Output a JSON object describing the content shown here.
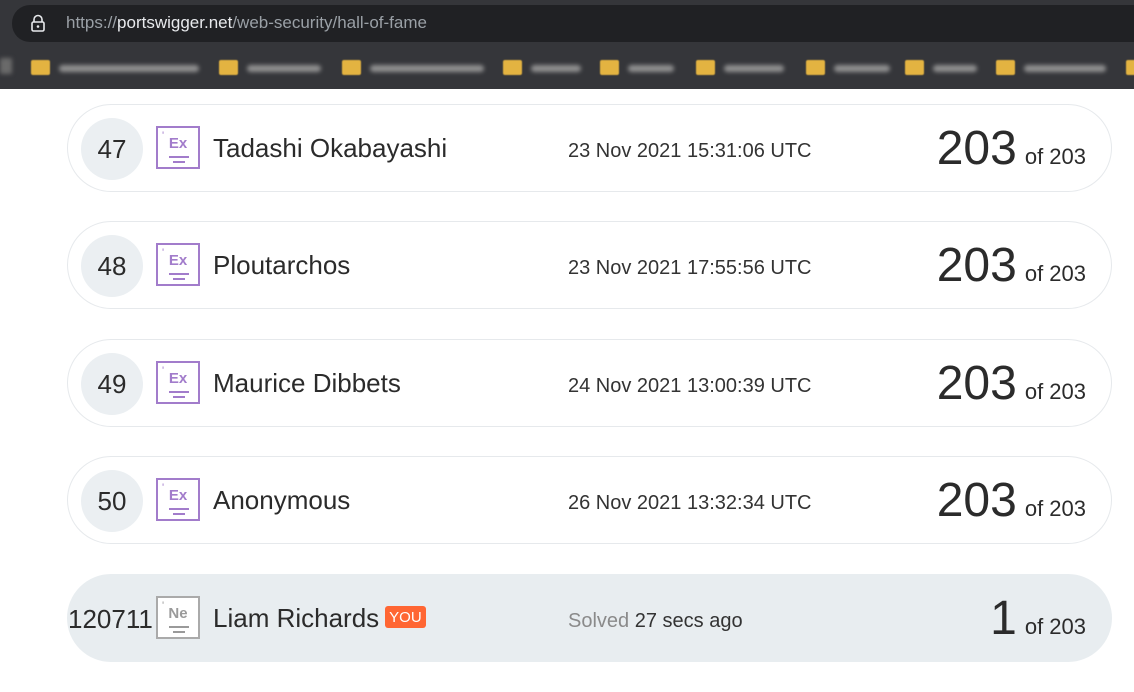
{
  "browser": {
    "url_scheme": "https://",
    "url_host": "portswigger.net",
    "url_path": "/web-security/hall-of-fame"
  },
  "bookmarks_bar": {
    "items": [
      {
        "icon": "folder-icon",
        "label_blurred": true
      },
      {
        "icon": "folder-icon",
        "label_blurred": true
      },
      {
        "icon": "folder-icon",
        "label_blurred": true
      },
      {
        "icon": "folder-icon",
        "label_blurred": true
      },
      {
        "icon": "folder-icon",
        "label_blurred": true
      },
      {
        "icon": "folder-icon",
        "label_blurred": true
      },
      {
        "icon": "folder-icon",
        "label_blurred": true
      },
      {
        "icon": "folder-icon",
        "label_blurred": true
      },
      {
        "icon": "folder-icon",
        "label_blurred": true
      }
    ]
  },
  "leaderboard": {
    "rows": [
      {
        "rank": "47",
        "badge": "Ex",
        "name": "Tadashi Okabayashi",
        "time": "23 Nov 2021 15:31:06 UTC",
        "score": "203",
        "total": "of 203"
      },
      {
        "rank": "48",
        "badge": "Ex",
        "name": "Ploutarchos",
        "time": "23 Nov 2021 17:55:56 UTC",
        "score": "203",
        "total": "of 203"
      },
      {
        "rank": "49",
        "badge": "Ex",
        "name": "Maurice Dibbets",
        "time": "24 Nov 2021 13:00:39 UTC",
        "score": "203",
        "total": "of 203"
      },
      {
        "rank": "50",
        "badge": "Ex",
        "name": "Anonymous",
        "time": "26 Nov 2021 13:32:34 UTC",
        "score": "203",
        "total": "of 203"
      }
    ],
    "current_user": {
      "rank": "120711",
      "badge": "Ne",
      "name": "Liam Richards",
      "you_tag": "YOU",
      "solved_label": "Solved",
      "time": "27 secs ago",
      "score": "1",
      "total": "of 203"
    }
  },
  "colors": {
    "expert_badge": "#a27ccb",
    "novice_badge": "#9a9a9a",
    "you_tag": "#ff6633",
    "current_row_bg": "#e8edf0"
  }
}
